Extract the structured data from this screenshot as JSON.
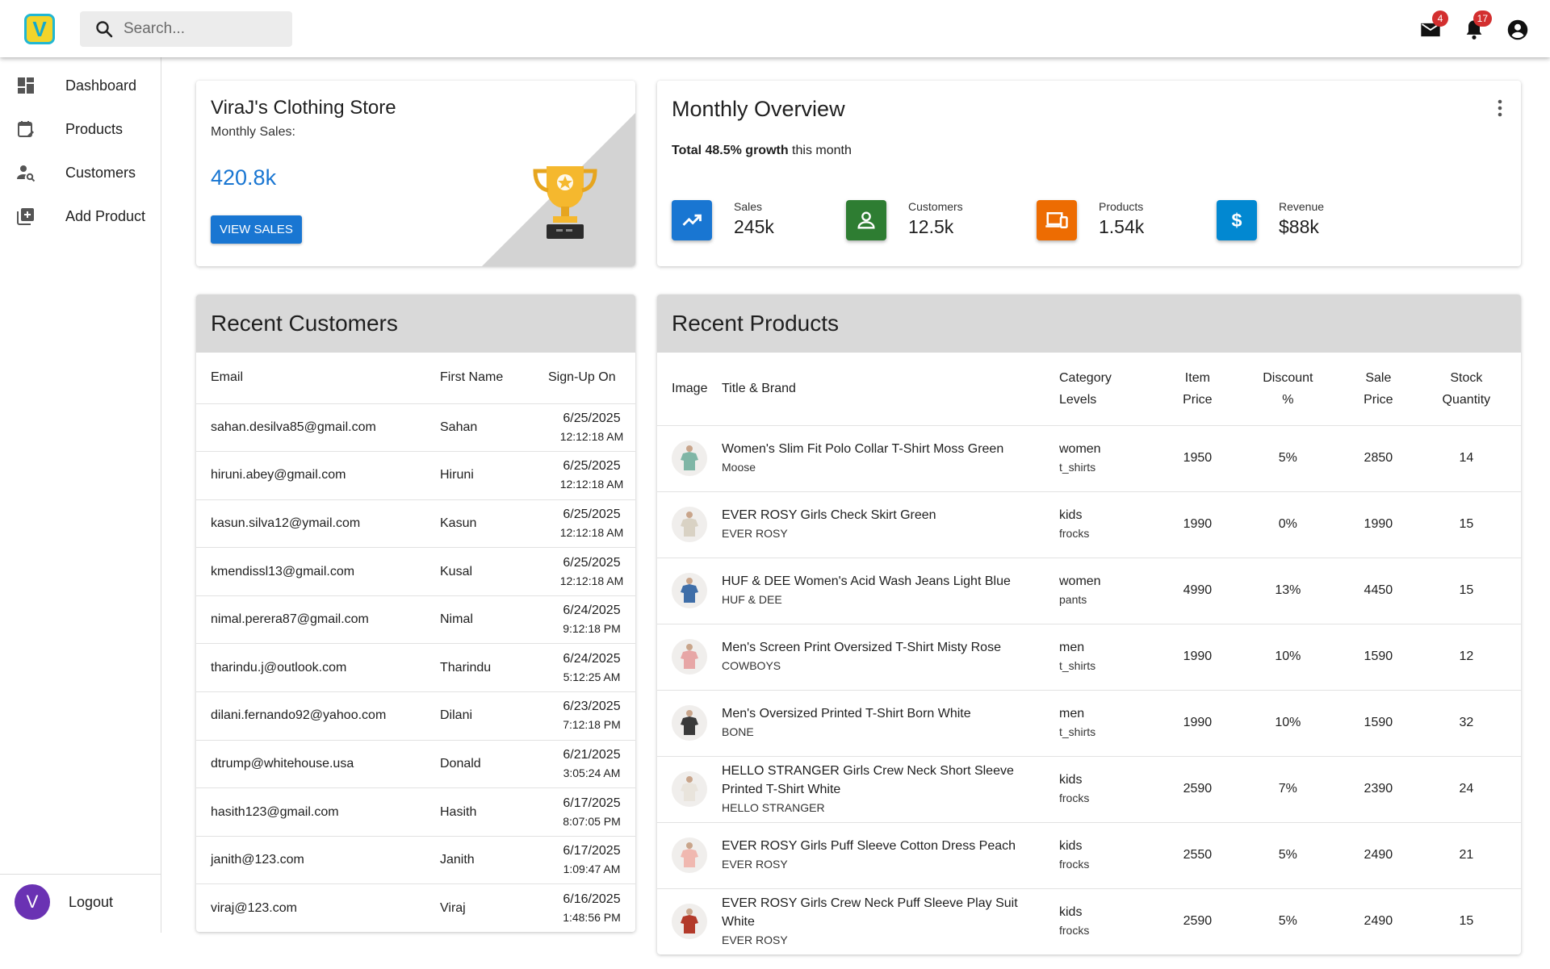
{
  "app": {
    "logo_letter": "V"
  },
  "search": {
    "placeholder": "Search..."
  },
  "topbar": {
    "mail_badge": "4",
    "notif_badge": "17"
  },
  "sidebar": {
    "items": [
      {
        "label": "Dashboard",
        "icon": "dashboard-icon"
      },
      {
        "label": "Products",
        "icon": "calendar-edit-icon"
      },
      {
        "label": "Customers",
        "icon": "person-search-icon"
      },
      {
        "label": "Add Product",
        "icon": "add-box-icon"
      }
    ],
    "avatar_letter": "V",
    "logout_label": "Logout"
  },
  "store": {
    "title": "ViraJ's Clothing Store",
    "subtitle": "Monthly Sales:",
    "amount": "420.8k",
    "button": "VIEW SALES"
  },
  "overview": {
    "title": "Monthly Overview",
    "growth_prefix": "Total 48.5% growth",
    "growth_suffix": " this month",
    "stats": [
      {
        "label": "Sales",
        "value": "245k",
        "color": "#1976d2",
        "icon": "trending-up-icon"
      },
      {
        "label": "Customers",
        "value": "12.5k",
        "color": "#2e7d32",
        "icon": "person-icon"
      },
      {
        "label": "Products",
        "value": "1.54k",
        "color": "#ed6c02",
        "icon": "devices-icon"
      },
      {
        "label": "Revenue",
        "value": "$88k",
        "color": "#0288d1",
        "icon": "dollar-icon"
      }
    ]
  },
  "customers": {
    "title": "Recent Customers",
    "headers": [
      "Email",
      "First Name",
      "Sign-Up On"
    ],
    "rows": [
      {
        "email": "sahan.desilva85@gmail.com",
        "name": "Sahan",
        "date": "6/25/2025",
        "time": "12:12:18 AM"
      },
      {
        "email": "hiruni.abey@gmail.com",
        "name": "Hiruni",
        "date": "6/25/2025",
        "time": "12:12:18 AM"
      },
      {
        "email": "kasun.silva12@ymail.com",
        "name": "Kasun",
        "date": "6/25/2025",
        "time": "12:12:18 AM"
      },
      {
        "email": "kmendissl13@gmail.com",
        "name": "Kusal",
        "date": "6/25/2025",
        "time": "12:12:18 AM"
      },
      {
        "email": "nimal.perera87@gmail.com",
        "name": "Nimal",
        "date": "6/24/2025",
        "time": "9:12:18 PM"
      },
      {
        "email": "tharindu.j@outlook.com",
        "name": "Tharindu",
        "date": "6/24/2025",
        "time": "5:12:25 AM"
      },
      {
        "email": "dilani.fernando92@yahoo.com",
        "name": "Dilani",
        "date": "6/23/2025",
        "time": "7:12:18 PM"
      },
      {
        "email": "dtrump@whitehouse.usa",
        "name": "Donald",
        "date": "6/21/2025",
        "time": "3:05:24 AM"
      },
      {
        "email": "hasith123@gmail.com",
        "name": "Hasith",
        "date": "6/17/2025",
        "time": "8:07:05 PM"
      },
      {
        "email": "janith@123.com",
        "name": "Janith",
        "date": "6/17/2025",
        "time": "1:09:47 AM"
      },
      {
        "email": "viraj@123.com",
        "name": "Viraj",
        "date": "6/16/2025",
        "time": "1:48:56 PM"
      }
    ]
  },
  "products": {
    "title": "Recent Products",
    "headers": {
      "image": "Image",
      "title": "Title & Brand",
      "cat1": "Category",
      "cat2": "Levels",
      "price1": "Item",
      "price2": "Price",
      "disc1": "Discount",
      "disc2": "%",
      "sale1": "Sale",
      "sale2": "Price",
      "stock1": "Stock",
      "stock2": "Quantity"
    },
    "rows": [
      {
        "title": "Women's Slim Fit Polo Collar T-Shirt Moss Green",
        "brand": "Moose",
        "cat": "women",
        "sub": "t_shirts",
        "price": "1950",
        "discount": "5%",
        "sale": "2850",
        "stock": "14",
        "thumb": "#7fb6a6"
      },
      {
        "title": "EVER ROSY Girls Check Skirt Green",
        "brand": "EVER ROSY",
        "cat": "kids",
        "sub": "frocks",
        "price": "1990",
        "discount": "0%",
        "sale": "1990",
        "stock": "15",
        "thumb": "#d9d2c4"
      },
      {
        "title": "HUF & DEE Women's Acid Wash Jeans Light Blue",
        "brand": "HUF & DEE",
        "cat": "women",
        "sub": "pants",
        "price": "4990",
        "discount": "13%",
        "sale": "4450",
        "stock": "15",
        "thumb": "#3f6ea8"
      },
      {
        "title": "Men's Screen Print Oversized T-Shirt Misty Rose",
        "brand": "COWBOYS",
        "cat": "men",
        "sub": "t_shirts",
        "price": "1990",
        "discount": "10%",
        "sale": "1590",
        "stock": "12",
        "thumb": "#e7a6a6"
      },
      {
        "title": "Men's Oversized Printed T-Shirt Born White",
        "brand": "BONE",
        "cat": "men",
        "sub": "t_shirts",
        "price": "1990",
        "discount": "10%",
        "sale": "1590",
        "stock": "32",
        "thumb": "#3a3a3a"
      },
      {
        "title": "HELLO STRANGER Girls Crew Neck Short Sleeve Printed T-Shirt White",
        "brand": "HELLO STRANGER",
        "cat": "kids",
        "sub": "frocks",
        "price": "2590",
        "discount": "7%",
        "sale": "2390",
        "stock": "24",
        "thumb": "#e9e4dc"
      },
      {
        "title": "EVER ROSY Girls Puff Sleeve Cotton Dress Peach",
        "brand": "EVER ROSY",
        "cat": "kids",
        "sub": "frocks",
        "price": "2550",
        "discount": "5%",
        "sale": "2490",
        "stock": "21",
        "thumb": "#f0b8b0"
      },
      {
        "title": "EVER ROSY Girls Crew Neck Puff Sleeve Play Suit White",
        "brand": "EVER ROSY",
        "cat": "kids",
        "sub": "frocks",
        "price": "2590",
        "discount": "5%",
        "sale": "2490",
        "stock": "15",
        "thumb": "#b33a2a"
      }
    ]
  }
}
